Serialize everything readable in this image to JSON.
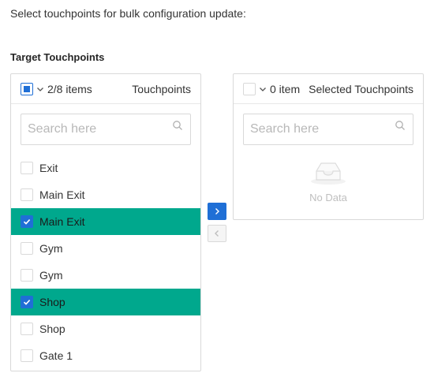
{
  "intro_text": "Select touchpoints for bulk configuration update:",
  "section_title": "Target Touchpoints",
  "colors": {
    "accent": "#1f6fd6",
    "selected_row": "#00a88d",
    "border": "#d9d9d9"
  },
  "source": {
    "count_label": "2/8 items",
    "title": "Touchpoints",
    "search_placeholder": "Search here",
    "items": [
      {
        "label": "Exit",
        "checked": false
      },
      {
        "label": "Main Exit",
        "checked": false
      },
      {
        "label": "Main Exit",
        "checked": true
      },
      {
        "label": "Gym",
        "checked": false
      },
      {
        "label": "Gym",
        "checked": false
      },
      {
        "label": "Shop",
        "checked": true
      },
      {
        "label": "Shop",
        "checked": false
      },
      {
        "label": "Gate 1",
        "checked": false
      }
    ]
  },
  "target": {
    "count_label": "0 item",
    "title": "Selected Touchpoints",
    "search_placeholder": "Search here",
    "empty_text": "No Data"
  },
  "icons": {
    "move_right": "chevron-right-icon",
    "move_left": "chevron-left-icon",
    "search": "search-icon",
    "dropdown": "chevron-down-icon",
    "empty": "inbox-icon"
  }
}
